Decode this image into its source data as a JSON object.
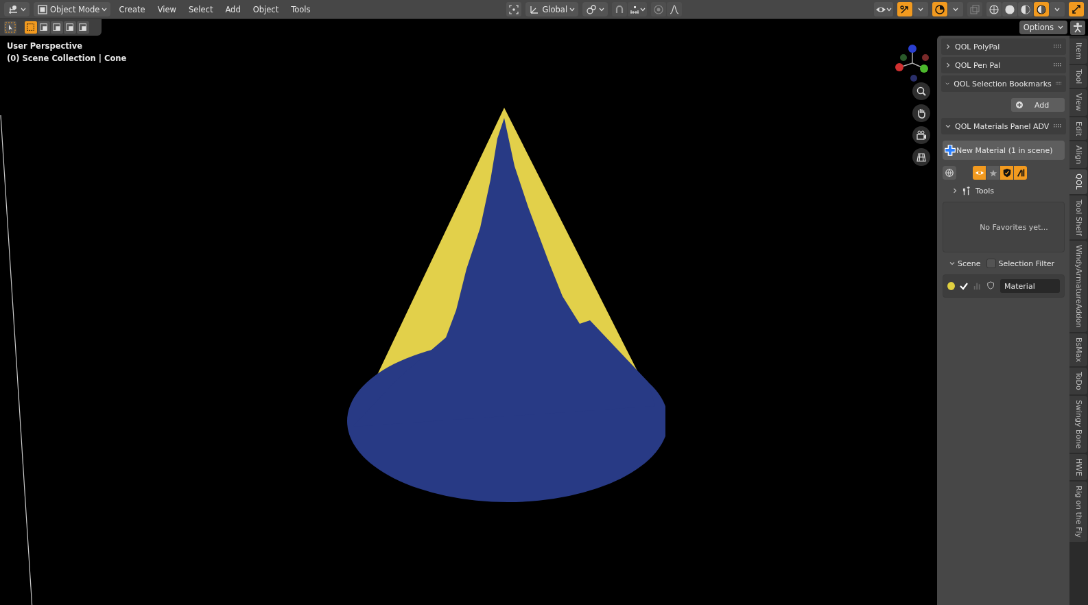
{
  "header": {
    "mode": "Object Mode",
    "menus": [
      "Create",
      "View",
      "Select",
      "Add",
      "Object",
      "Tools"
    ],
    "orientation": "Global",
    "gizmos_on": true,
    "overlays_on": true,
    "xray_on": false,
    "shading": [
      {
        "selected": false
      },
      {
        "selected": false
      },
      {
        "selected": false
      },
      {
        "selected": true
      }
    ],
    "options": "Options"
  },
  "select_modes": [
    {
      "selected": true
    },
    {
      "selected": false
    },
    {
      "selected": false
    },
    {
      "selected": false
    },
    {
      "selected": false
    }
  ],
  "viewport": {
    "title": "User Perspective",
    "subtitle": "(0) Scene Collection | Cone"
  },
  "sidebar": {
    "panels": [
      {
        "kind": "plain",
        "title": "QOL PolyPal",
        "expanded": false
      },
      {
        "kind": "plain",
        "title": "QOL Pen Pal",
        "expanded": false
      },
      {
        "kind": "bookmarks",
        "title": "QOL Selection Bookmarks",
        "expanded": true,
        "button": "Add"
      },
      {
        "kind": "materials",
        "title": "QOL Materials Panel ADV",
        "expanded": true,
        "new_button": "New Material (1 in scene)",
        "filters": [
          {
            "on": true
          },
          {
            "on": false
          },
          {
            "on": true
          },
          {
            "on": true
          }
        ],
        "tools": {
          "label": "Tools",
          "expanded": false
        },
        "favorites": "No Favorites yet...",
        "scene": {
          "label": "Scene",
          "expanded": true
        },
        "selection_filter": {
          "label": "Selection Filter",
          "checked": false
        },
        "materials": [
          {
            "name": "Material",
            "color": "#e0d040",
            "checked": true
          }
        ]
      }
    ]
  },
  "tabs": [
    {
      "label": "Item",
      "selected": false
    },
    {
      "label": "Tool",
      "selected": false
    },
    {
      "label": "View",
      "selected": false
    },
    {
      "label": "Edit",
      "selected": false
    },
    {
      "label": "Align",
      "selected": false
    },
    {
      "label": "QOL",
      "selected": true
    },
    {
      "label": "Tool Shelf",
      "selected": false
    },
    {
      "label": "WindyArmatureAddon",
      "selected": false
    },
    {
      "label": "BsMax",
      "selected": false
    },
    {
      "label": "ToDo",
      "selected": false
    },
    {
      "label": "Swingy Bone",
      "selected": false
    },
    {
      "label": "HWE",
      "selected": false
    },
    {
      "label": "Rig on the Fly",
      "selected": false
    }
  ]
}
